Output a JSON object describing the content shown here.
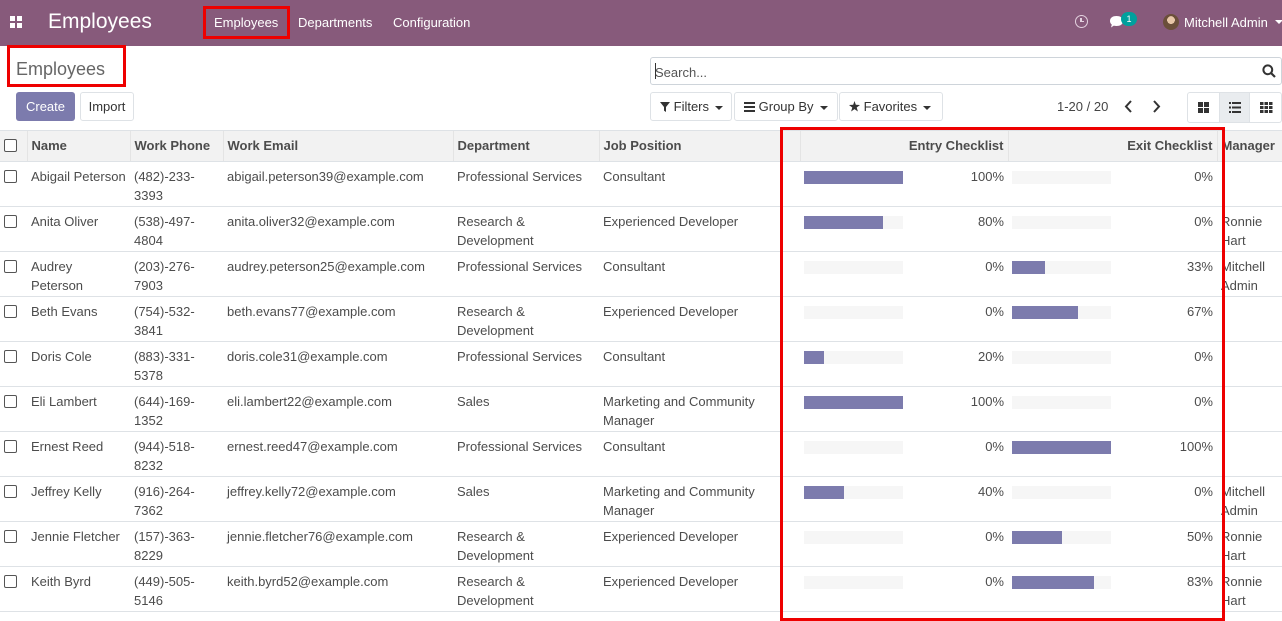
{
  "navbar": {
    "app_title": "Employees",
    "menu": [
      "Employees",
      "Departments",
      "Configuration"
    ],
    "chat_badge": "1",
    "user_name": "Mitchell Admin",
    "color": "#875a7b"
  },
  "control_panel": {
    "breadcrumb": "Employees",
    "create_label": "Create",
    "import_label": "Import",
    "search_placeholder": "Search...",
    "filters_label": "Filters",
    "groupby_label": "Group By",
    "favorites_label": "Favorites",
    "pager": "1-20 / 20"
  },
  "table": {
    "headers": {
      "name": "Name",
      "phone": "Work Phone",
      "email": "Work Email",
      "department": "Department",
      "job": "Job Position",
      "entry": "Entry Checklist",
      "exit": "Exit Checklist",
      "manager": "Manager"
    },
    "rows": [
      {
        "name": "Abigail Peterson",
        "phone": "(482)-233-3393",
        "email": "abigail.peterson39@example.com",
        "department": "Professional Services",
        "job": "Consultant",
        "entry_pct": 100,
        "entry": "100%",
        "exit_pct": 0,
        "exit": "0%",
        "manager": ""
      },
      {
        "name": "Anita Oliver",
        "phone": "(538)-497-4804",
        "email": "anita.oliver32@example.com",
        "department": "Research & Development",
        "job": "Experienced Developer",
        "entry_pct": 80,
        "entry": "80%",
        "exit_pct": 0,
        "exit": "0%",
        "manager": "Ronnie Hart"
      },
      {
        "name": "Audrey Peterson",
        "phone": "(203)-276-7903",
        "email": "audrey.peterson25@example.com",
        "department": "Professional Services",
        "job": "Consultant",
        "entry_pct": 0,
        "entry": "0%",
        "exit_pct": 33,
        "exit": "33%",
        "manager": "Mitchell Admin"
      },
      {
        "name": "Beth Evans",
        "phone": "(754)-532-3841",
        "email": "beth.evans77@example.com",
        "department": "Research & Development",
        "job": "Experienced Developer",
        "entry_pct": 0,
        "entry": "0%",
        "exit_pct": 67,
        "exit": "67%",
        "manager": ""
      },
      {
        "name": "Doris Cole",
        "phone": "(883)-331-5378",
        "email": "doris.cole31@example.com",
        "department": "Professional Services",
        "job": "Consultant",
        "entry_pct": 20,
        "entry": "20%",
        "exit_pct": 0,
        "exit": "0%",
        "manager": ""
      },
      {
        "name": "Eli Lambert",
        "phone": "(644)-169-1352",
        "email": "eli.lambert22@example.com",
        "department": "Sales",
        "job": "Marketing and Community Manager",
        "entry_pct": 100,
        "entry": "100%",
        "exit_pct": 0,
        "exit": "0%",
        "manager": ""
      },
      {
        "name": "Ernest Reed",
        "phone": "(944)-518-8232",
        "email": "ernest.reed47@example.com",
        "department": "Professional Services",
        "job": "Consultant",
        "entry_pct": 0,
        "entry": "0%",
        "exit_pct": 100,
        "exit": "100%",
        "manager": ""
      },
      {
        "name": "Jeffrey Kelly",
        "phone": "(916)-264-7362",
        "email": "jeffrey.kelly72@example.com",
        "department": "Sales",
        "job": "Marketing and Community Manager",
        "entry_pct": 40,
        "entry": "40%",
        "exit_pct": 0,
        "exit": "0%",
        "manager": "Mitchell Admin"
      },
      {
        "name": "Jennie Fletcher",
        "phone": "(157)-363-8229",
        "email": "jennie.fletcher76@example.com",
        "department": "Research & Development",
        "job": "Experienced Developer",
        "entry_pct": 0,
        "entry": "0%",
        "exit_pct": 50,
        "exit": "50%",
        "manager": "Ronnie Hart"
      },
      {
        "name": "Keith Byrd",
        "phone": "(449)-505-5146",
        "email": "keith.byrd52@example.com",
        "department": "Research & Development",
        "job": "Experienced Developer",
        "entry_pct": 0,
        "entry": "0%",
        "exit_pct": 83,
        "exit": "83%",
        "manager": "Ronnie Hart"
      }
    ]
  },
  "colors": {
    "primary": "#7c7bad",
    "annotation": "#ee0000"
  }
}
